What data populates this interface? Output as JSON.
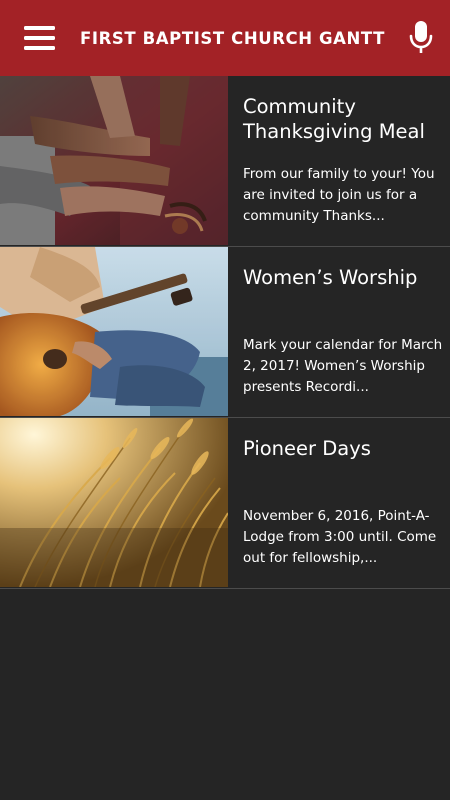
{
  "app_bar": {
    "title": "FIRST BAPTIST CHURCH GANTT",
    "menu_icon": "hamburger-menu-icon",
    "mic_icon": "microphone-icon",
    "background_color": "#a32226"
  },
  "feed": {
    "items": [
      {
        "title": "Community Thanksgiving Meal",
        "excerpt": "From our family to your! You are invited to join us for a community Thanks...",
        "image": "stacked-hands-photo"
      },
      {
        "title": "Women’s Worship",
        "excerpt": "Mark your calendar for March 2, 2017! Women’s Worship presents Recordi...",
        "image": "guitar-player-photo"
      },
      {
        "title": "Pioneer Days",
        "excerpt": "November 6, 2016, Point-A-Lodge from 3:00 until. Come out for fellowship,...",
        "image": "wheat-field-photo"
      }
    ]
  }
}
